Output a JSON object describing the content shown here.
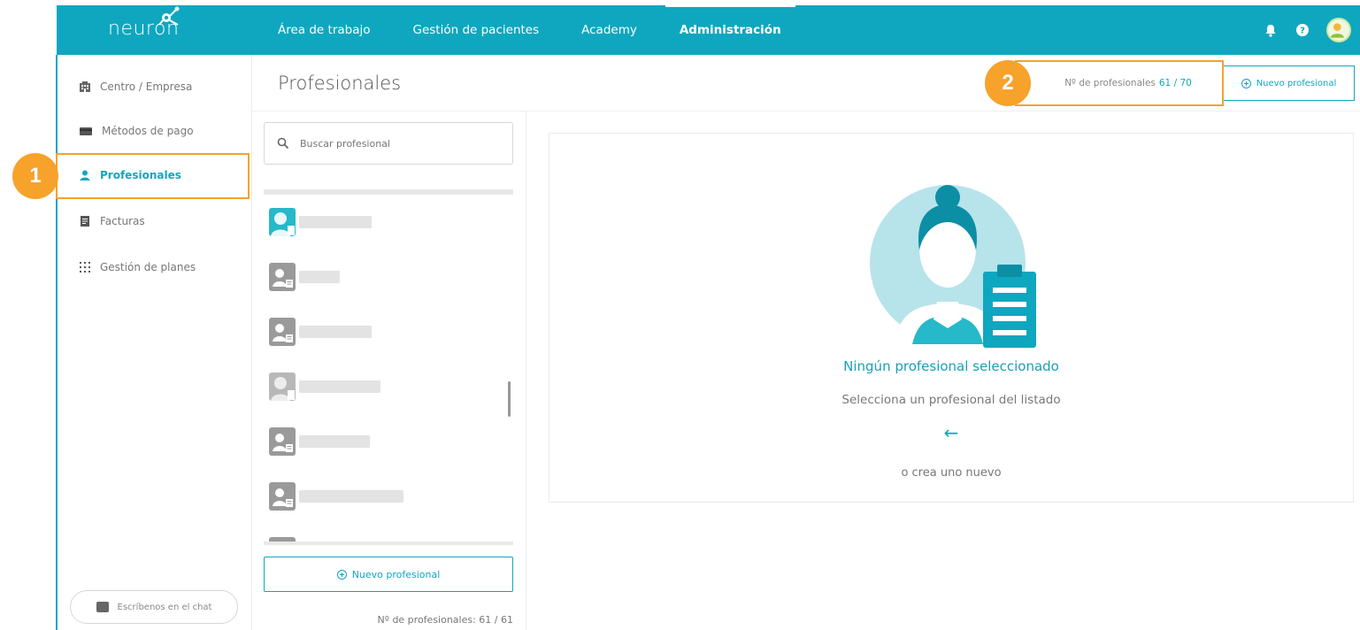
{
  "app": {
    "logo_text": "neuron"
  },
  "topnav": {
    "items": [
      {
        "label": "Área de trabajo"
      },
      {
        "label": "Gestión de pacientes"
      },
      {
        "label": "Academy"
      },
      {
        "label": "Administración",
        "active": true
      }
    ]
  },
  "sidebar": {
    "items": [
      {
        "label": "Centro / Empresa",
        "icon": "building-icon"
      },
      {
        "label": "Métodos de pago",
        "icon": "credit-card-icon"
      },
      {
        "label": "Profesionales",
        "icon": "person-icon",
        "active": true
      },
      {
        "label": "Facturas",
        "icon": "invoice-icon"
      },
      {
        "label": "Gestión de planes",
        "icon": "grid-dots-icon"
      }
    ],
    "chat_label": "Escríbenos en el chat"
  },
  "page": {
    "title": "Profesionales",
    "count_label": "Nº de profesionales",
    "count_value": "61 / 70",
    "new_button": "Nuevo profesional"
  },
  "list": {
    "search_placeholder": "Buscar profesional",
    "new_button": "Nuevo profesional",
    "footer_count": "Nº de profesionales: 61 / 61"
  },
  "detail": {
    "empty_title": "Ningún profesional seleccionado",
    "empty_subtitle": "Selecciona un profesional del listado",
    "arrow": "←",
    "empty_or": "o crea uno nuevo"
  },
  "callouts": [
    {
      "number": "1"
    },
    {
      "number": "2"
    }
  ],
  "colors": {
    "brand": "#0ea7bf",
    "callout": "#f7a22b"
  }
}
